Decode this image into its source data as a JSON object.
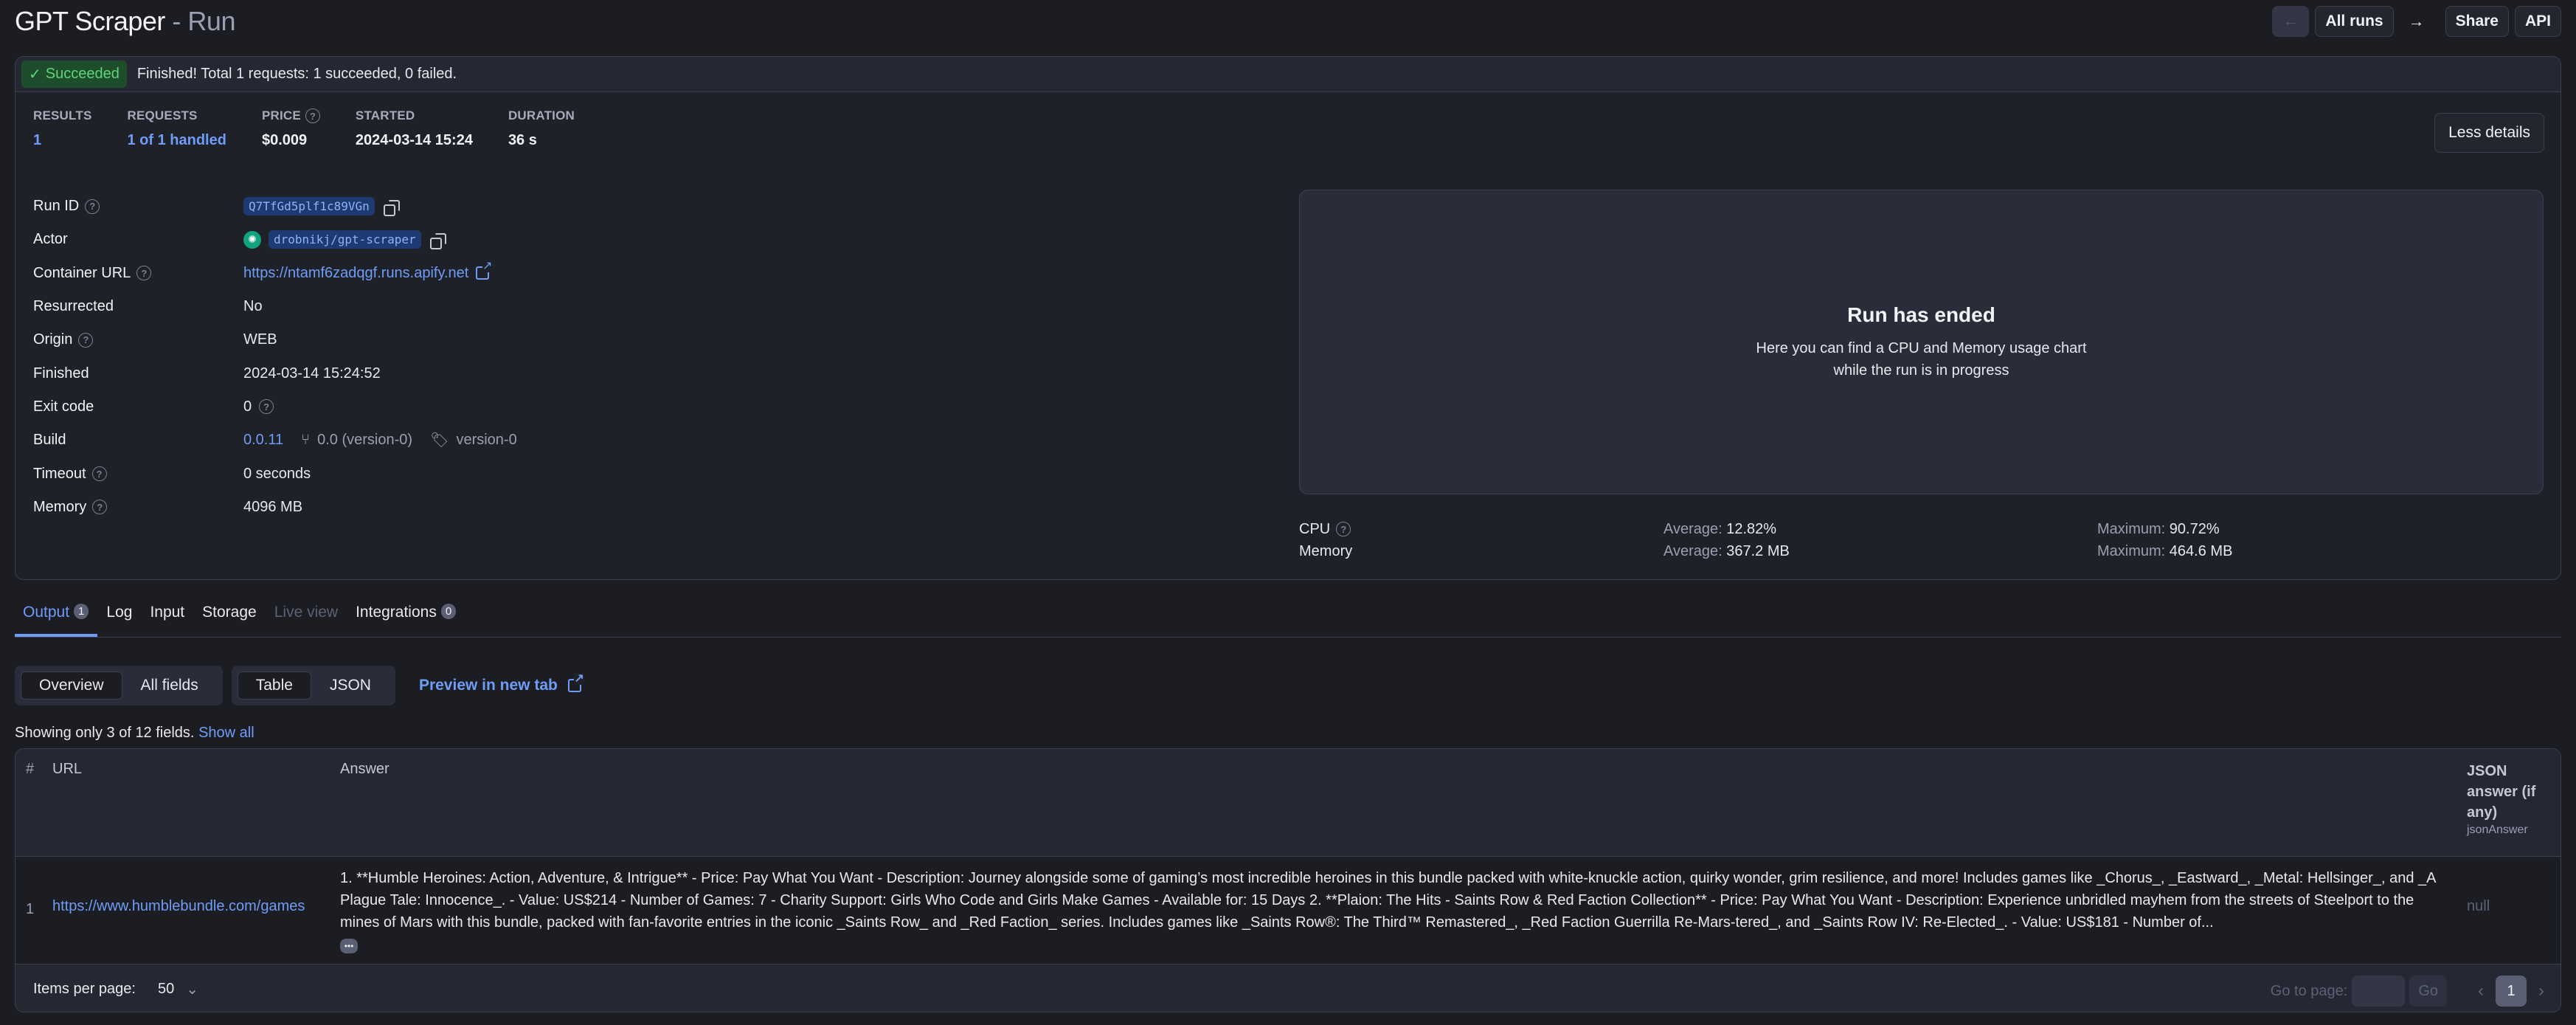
{
  "header": {
    "title": "GPT Scraper",
    "separator": " - ",
    "subtitle": "Run",
    "back_icon": "arrow-left-icon",
    "all_runs_label": "All runs",
    "forward_icon": "arrow-right-icon",
    "share_label": "Share",
    "api_label": "API"
  },
  "status": {
    "badge": "Succeeded",
    "message": "Finished! Total 1 requests: 1 succeeded, 0 failed.",
    "color": "#5fd47c"
  },
  "stats": [
    {
      "label": "RESULTS",
      "value": "1",
      "link": true,
      "help": false
    },
    {
      "label": "REQUESTS",
      "value": "1 of 1 handled",
      "link": true,
      "help": false
    },
    {
      "label": "PRICE",
      "value": "$0.009",
      "link": false,
      "help": true
    },
    {
      "label": "STARTED",
      "value": "2024-03-14 15:24",
      "link": false,
      "help": false
    },
    {
      "label": "DURATION",
      "value": "36 s",
      "link": false,
      "help": false
    }
  ],
  "less_details_label": "Less details",
  "properties": {
    "run_id": {
      "label": "Run ID",
      "value": "Q7TfGd5plf1c89VGn"
    },
    "actor": {
      "label": "Actor",
      "value": "drobnikj/gpt-scraper"
    },
    "container_url": {
      "label": "Container URL",
      "value": "https://ntamf6zadqgf.runs.apify.net"
    },
    "resurrected": {
      "label": "Resurrected",
      "value": "No"
    },
    "origin": {
      "label": "Origin",
      "value": "WEB"
    },
    "finished": {
      "label": "Finished",
      "value": "2024-03-14 15:24:52"
    },
    "exit_code": {
      "label": "Exit code",
      "value": "0"
    },
    "build": {
      "label": "Build",
      "value": "0.0.11",
      "branch": "0.0 (version-0)",
      "tag": "version-0"
    },
    "timeout": {
      "label": "Timeout",
      "value": "0 seconds"
    },
    "memory": {
      "label": "Memory",
      "value": "4096 MB"
    }
  },
  "chart_panel": {
    "title": "Run has ended",
    "line1": "Here you can find a CPU and Memory usage chart",
    "line2": "while the run is in progress"
  },
  "usage": {
    "cpu": {
      "label": "CPU",
      "avg_label": "Average:",
      "avg": "12.82%",
      "max_label": "Maximum:",
      "max": "90.72%"
    },
    "memory": {
      "label": "Memory",
      "avg_label": "Average:",
      "avg": "367.2 MB",
      "max_label": "Maximum:",
      "max": "464.6 MB"
    }
  },
  "tabs": [
    {
      "label": "Output",
      "count": "1",
      "state": "active"
    },
    {
      "label": "Log",
      "state": "normal"
    },
    {
      "label": "Input",
      "state": "normal"
    },
    {
      "label": "Storage",
      "state": "normal"
    },
    {
      "label": "Live view",
      "state": "disabled"
    },
    {
      "label": "Integrations",
      "count": "0",
      "state": "normal"
    }
  ],
  "view_toggle": {
    "overview": "Overview",
    "all_fields": "All fields",
    "selected": "Overview"
  },
  "format_toggle": {
    "table": "Table",
    "json": "JSON",
    "selected": "Table"
  },
  "preview_link": "Preview in new tab",
  "showing_text": "Showing only 3 of 12 fields.",
  "show_all_label": "Show all",
  "table": {
    "columns": {
      "hash": "#",
      "url": "URL",
      "answer": "Answer",
      "json": "JSON answer (if any)",
      "json_key": "jsonAnswer"
    },
    "rows": [
      {
        "num": "1",
        "url": "https://www.humblebundle.com/games",
        "answer": "1. **Humble Heroines: Action, Adventure, & Intrigue** - Price: Pay What You Want - Description: Journey alongside some of gaming’s most incredible heroines in this bundle packed with white-knuckle action, quirky wonder, grim resilience, and more! Includes games like _Chorus_, _Eastward_, _Metal: Hellsinger_, and _A Plague Tale: Innocence_. - Value: US$214 - Number of Games: 7 - Charity Support: Girls Who Code and Girls Make Games - Available for: 15 Days 2. **Plaion: The Hits - Saints Row & Red Faction Collection** - Price: Pay What You Want - Description: Experience unbridled mayhem from the streets of Steelport to the mines of Mars with this bundle, packed with fan-favorite entries in the iconic _Saints Row_ and _Red Faction_ series. Includes games like _Saints Row®: The Third™ Remastered_, _Red Faction Guerrilla Re-Mars-tered_, and _Saints Row IV: Re-Elected_. - Value: US$181 - Number of...",
        "json": "null"
      }
    ]
  },
  "footer": {
    "items_per_page_label": "Items per page:",
    "items_per_page": "50",
    "goto_label": "Go to page:",
    "goto_value": "",
    "go_label": "Go",
    "current_page": "1"
  }
}
